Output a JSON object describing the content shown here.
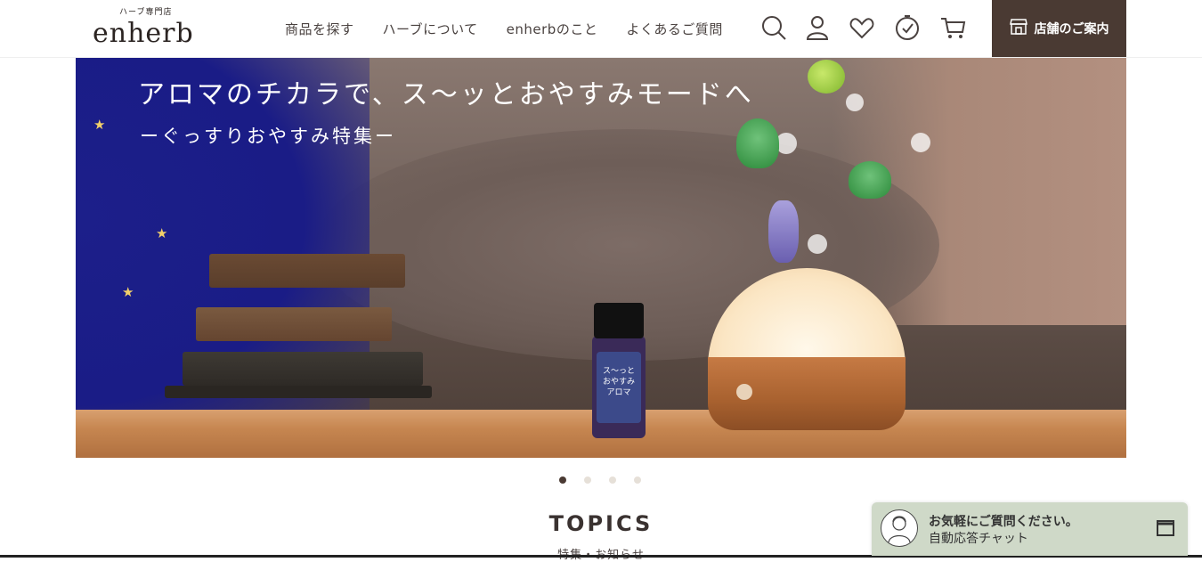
{
  "header": {
    "logo_sub": "ハーブ専門店",
    "logo_main": "enherb",
    "nav": [
      "商品を探す",
      "ハーブについて",
      "enherbのこと",
      "よくあるご質問"
    ],
    "icons": [
      "search-icon",
      "account-icon",
      "favorite-icon",
      "history-icon",
      "cart-icon"
    ],
    "store_button": "店舗のご案内"
  },
  "hero": {
    "title": "アロマのチカラで、ス〜ッとおやすみモードへ",
    "subtitle": "ーぐっすりおやすみ特集ー",
    "bottle_label": "ス〜っと\nおやすみ\nアロマ"
  },
  "carousel": {
    "total": 4,
    "active": 1
  },
  "topics": {
    "title": "TOPICS",
    "subtitle": "特集・お知らせ"
  },
  "chat": {
    "title": "お気軽にご質問ください。",
    "subtitle": "自動応答チャット"
  },
  "colors": {
    "brand": "#4a3a33",
    "hero_blue": "#1a1c86",
    "chat_bg": "#cfd9c8"
  }
}
